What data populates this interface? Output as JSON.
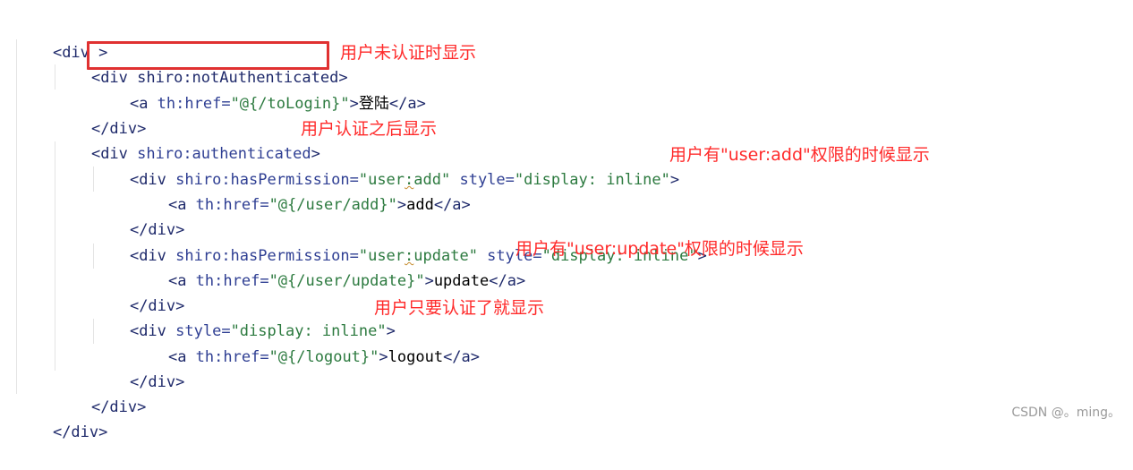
{
  "code": {
    "l1": {
      "open": "<div",
      "close": " >"
    },
    "l2": {
      "open": "<div",
      "attr": " shiro:notAuthenticated",
      "close": ">"
    },
    "l3": {
      "open": "<a",
      "attr": " th:href=",
      "val": "\"@{/toLogin}\"",
      "close": ">",
      "text": "登陆",
      "end": "</a>"
    },
    "l4": {
      "end": "</div>"
    },
    "l5": {
      "open": "<div",
      "attr": " shiro:authenticated",
      "close": ">"
    },
    "l6": {
      "open": "<div",
      "attr1": " shiro:hasPermission=",
      "val1a": "\"user",
      "val1b": ":",
      "val1c": "add\"",
      "attr2": " style=",
      "val2": "\"display: inline\"",
      "close": ">"
    },
    "l7": {
      "open": "<a",
      "attr": " th:href=",
      "val": "\"@{/user/add}\"",
      "close": ">",
      "text": "add",
      "end": "</a>"
    },
    "l8": {
      "end": "</div>"
    },
    "l9": {
      "open": "<div",
      "attr1": " shiro:hasPermission=",
      "val1a": "\"user",
      "val1b": ":",
      "val1c": "update\"",
      "attr2": " style=",
      "val2": "\"display: inline\"",
      "close": ">"
    },
    "l10": {
      "open": "<a",
      "attr": " th:href=",
      "val": "\"@{/user/update}\"",
      "close": ">",
      "text": "update",
      "end": "</a>"
    },
    "l11": {
      "end": "</div>"
    },
    "l12": {
      "open": "<div",
      "attr": " style=",
      "val": "\"display: inline\"",
      "close": ">"
    },
    "l13": {
      "open": "<a",
      "attr": " th:href=",
      "val": "\"@{/logout}\"",
      "close": ">",
      "text": "logout",
      "end": "</a>"
    },
    "l14": {
      "end": "</div>"
    },
    "l15": {
      "end": "</div>"
    },
    "l16": {
      "end": "</div>"
    }
  },
  "notes": {
    "not_authenticated": "用户未认证时显示",
    "authenticated": "用户认证之后显示",
    "perm_add": "用户有\"user:add\"权限的时候显示",
    "perm_update": "用户有\"user:update\"权限的时候显示",
    "inline_auth": "用户只要认证了就显示"
  },
  "watermark": "CSDN @。ming。",
  "colors": {
    "annotation": "#ff2a2a",
    "box": "#e03131",
    "tag": "#1f2a6b",
    "string": "#2c7a3f"
  }
}
